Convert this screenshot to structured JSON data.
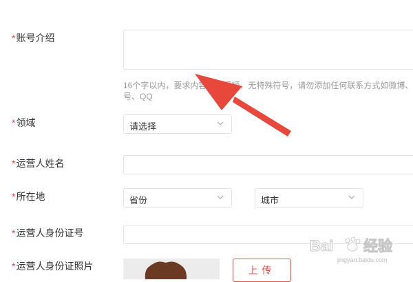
{
  "form": {
    "intro": {
      "label": "账号介绍",
      "value": "",
      "hint_line1": "16个字以内，要求内容完整通顺，无特殊符号，请勿添加任何联系方式如微博、",
      "hint_line2": "号、QQ"
    },
    "domain": {
      "label": "领域",
      "selected": "请选择"
    },
    "operator_name": {
      "label": "运营人姓名",
      "value": ""
    },
    "location": {
      "label": "所在地",
      "province": "省份",
      "city": "城市"
    },
    "operator_id": {
      "label": "运营人身份证号",
      "value": ""
    },
    "operator_photo": {
      "label": "运营人身份证照片",
      "upload_label": "上传"
    }
  },
  "required_mark": "*",
  "watermark": {
    "brand": "Bai",
    "brand2": "经验",
    "url": "jingyan.baidu.com"
  },
  "colors": {
    "required": "#e8473b",
    "arrow": "#e8473b",
    "upload": "#e05040"
  },
  "icons": {
    "chevron": "chevron-down-icon",
    "paw": "paw-icon"
  }
}
